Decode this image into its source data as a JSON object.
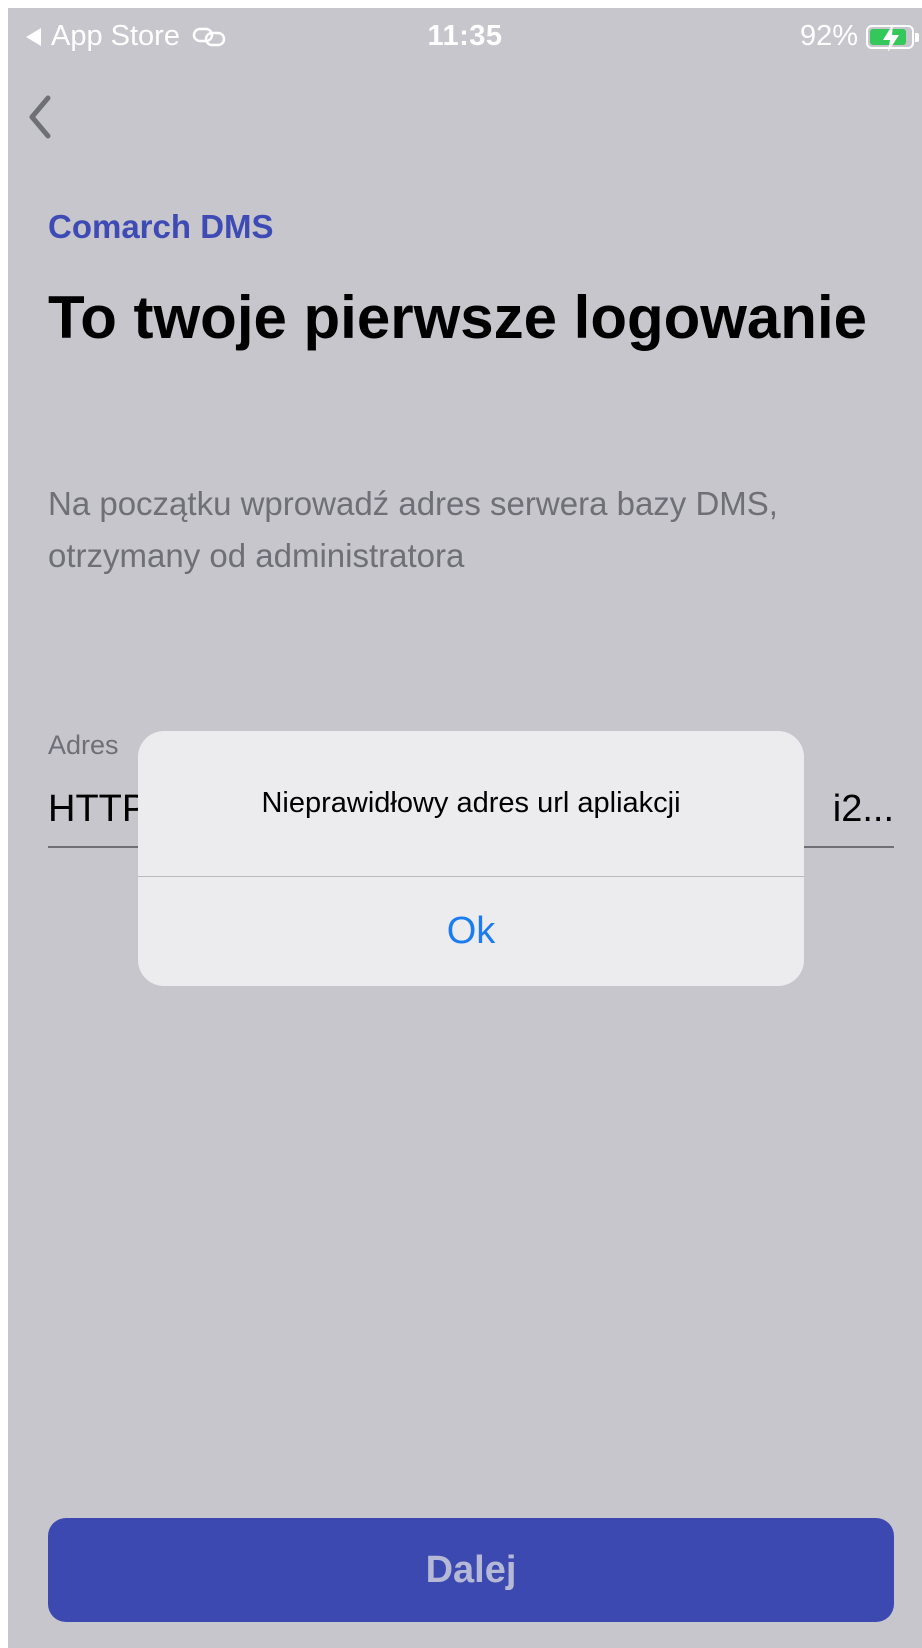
{
  "status_bar": {
    "back_app": "App Store",
    "time": "11:35",
    "battery": "92%",
    "battery_level": 0.92,
    "battery_color": "#34c759"
  },
  "nav": {
    "back_icon": "chevron-left-icon"
  },
  "header": {
    "app_name": "Comarch DMS",
    "title": "To twoje pierwsze logowanie",
    "subtitle": "Na początku wprowadź adres serwera bazy DMS, otrzymany od administratora"
  },
  "field": {
    "label": "Adres",
    "value_start": "HTTP",
    "value_end": "i2..."
  },
  "next_button": {
    "label": "Dalej"
  },
  "alert": {
    "message": "Nieprawidłowy adres url apliakcji",
    "ok_label": "Ok"
  },
  "colors": {
    "accent": "#3c49b1",
    "brand_text": "#3e4bb5",
    "link_blue": "#1a7cf0",
    "dim_background": "#c7c6cc"
  }
}
